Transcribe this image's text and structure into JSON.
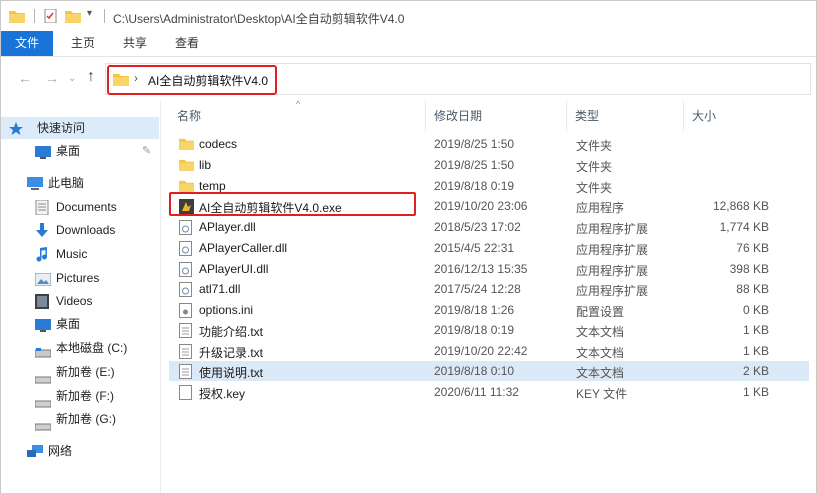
{
  "titlebar": {
    "path": "C:\\Users\\Administrator\\Desktop\\AI全自动剪辑软件V4.0",
    "dropdown": "▾"
  },
  "ribbon": {
    "tabs": [
      {
        "label": "文件",
        "active": true
      },
      {
        "label": "主页"
      },
      {
        "label": "共享"
      },
      {
        "label": "查看"
      }
    ]
  },
  "address": {
    "back": "←",
    "forward": "→",
    "recent": "⌄",
    "up": "↑",
    "chevron": "›",
    "current": "AI全自动剪辑软件V4.0"
  },
  "nav": {
    "items": [
      {
        "label": "快速访问",
        "icon": "star-icon"
      },
      {
        "label": "桌面",
        "icon": "desktop-icon",
        "pinned": true
      },
      {
        "label": "此电脑",
        "icon": "computer-icon"
      },
      {
        "label": "Documents",
        "icon": "document-icon"
      },
      {
        "label": "Downloads",
        "icon": "download-icon"
      },
      {
        "label": "Music",
        "icon": "music-icon"
      },
      {
        "label": "Pictures",
        "icon": "pictures-icon"
      },
      {
        "label": "Videos",
        "icon": "videos-icon"
      },
      {
        "label": "桌面",
        "icon": "desktop-icon"
      },
      {
        "label": "本地磁盘 (C:)",
        "icon": "drive-icon"
      },
      {
        "label": "新加卷 (E:)",
        "icon": "drive-icon"
      },
      {
        "label": "新加卷 (F:)",
        "icon": "drive-icon"
      },
      {
        "label": "新加卷 (G:)",
        "icon": "drive-icon"
      },
      {
        "label": "网络",
        "icon": "network-icon"
      }
    ]
  },
  "columns": {
    "name": "名称",
    "date": "修改日期",
    "type": "类型",
    "size": "大小",
    "sort_arrow": "^"
  },
  "files": [
    {
      "name": "codecs",
      "date": "2019/8/25 1:50",
      "type": "文件夹",
      "size": "",
      "icon": "folder-icon"
    },
    {
      "name": "lib",
      "date": "2019/8/25 1:50",
      "type": "文件夹",
      "size": "",
      "icon": "folder-icon"
    },
    {
      "name": "temp",
      "date": "2019/8/18 0:19",
      "type": "文件夹",
      "size": "",
      "icon": "folder-icon"
    },
    {
      "name": "AI全自动剪辑软件V4.0.exe",
      "date": "2019/10/20 23:06",
      "type": "应用程序",
      "size": "12,868 KB",
      "icon": "exe-icon"
    },
    {
      "name": "APlayer.dll",
      "date": "2018/5/23 17:02",
      "type": "应用程序扩展",
      "size": "1,774 KB",
      "icon": "dll-icon"
    },
    {
      "name": "APlayerCaller.dll",
      "date": "2015/4/5 22:31",
      "type": "应用程序扩展",
      "size": "76 KB",
      "icon": "dll-icon"
    },
    {
      "name": "APlayerUI.dll",
      "date": "2016/12/13 15:35",
      "type": "应用程序扩展",
      "size": "398 KB",
      "icon": "dll-icon"
    },
    {
      "name": "atl71.dll",
      "date": "2017/5/24 12:28",
      "type": "应用程序扩展",
      "size": "88 KB",
      "icon": "dll-icon"
    },
    {
      "name": "options.ini",
      "date": "2019/8/18 1:26",
      "type": "配置设置",
      "size": "0 KB",
      "icon": "ini-icon"
    },
    {
      "name": "功能介绍.txt",
      "date": "2019/8/18 0:19",
      "type": "文本文档",
      "size": "1 KB",
      "icon": "text-file-icon"
    },
    {
      "name": "升级记录.txt",
      "date": "2019/10/20 22:42",
      "type": "文本文档",
      "size": "1 KB",
      "icon": "text-file-icon"
    },
    {
      "name": "使用说明.txt",
      "date": "2019/8/18 0:10",
      "type": "文本文档",
      "size": "2 KB",
      "icon": "text-file-icon",
      "selected": true
    },
    {
      "name": "授权.key",
      "date": "2020/6/11 11:32",
      "type": "KEY 文件",
      "size": "1 KB",
      "icon": "blank-file-icon"
    }
  ],
  "colors": {
    "accent": "#1a73d6",
    "highlight": "#e02020",
    "selection": "#dbe8f6",
    "folder": "#f4c542"
  }
}
